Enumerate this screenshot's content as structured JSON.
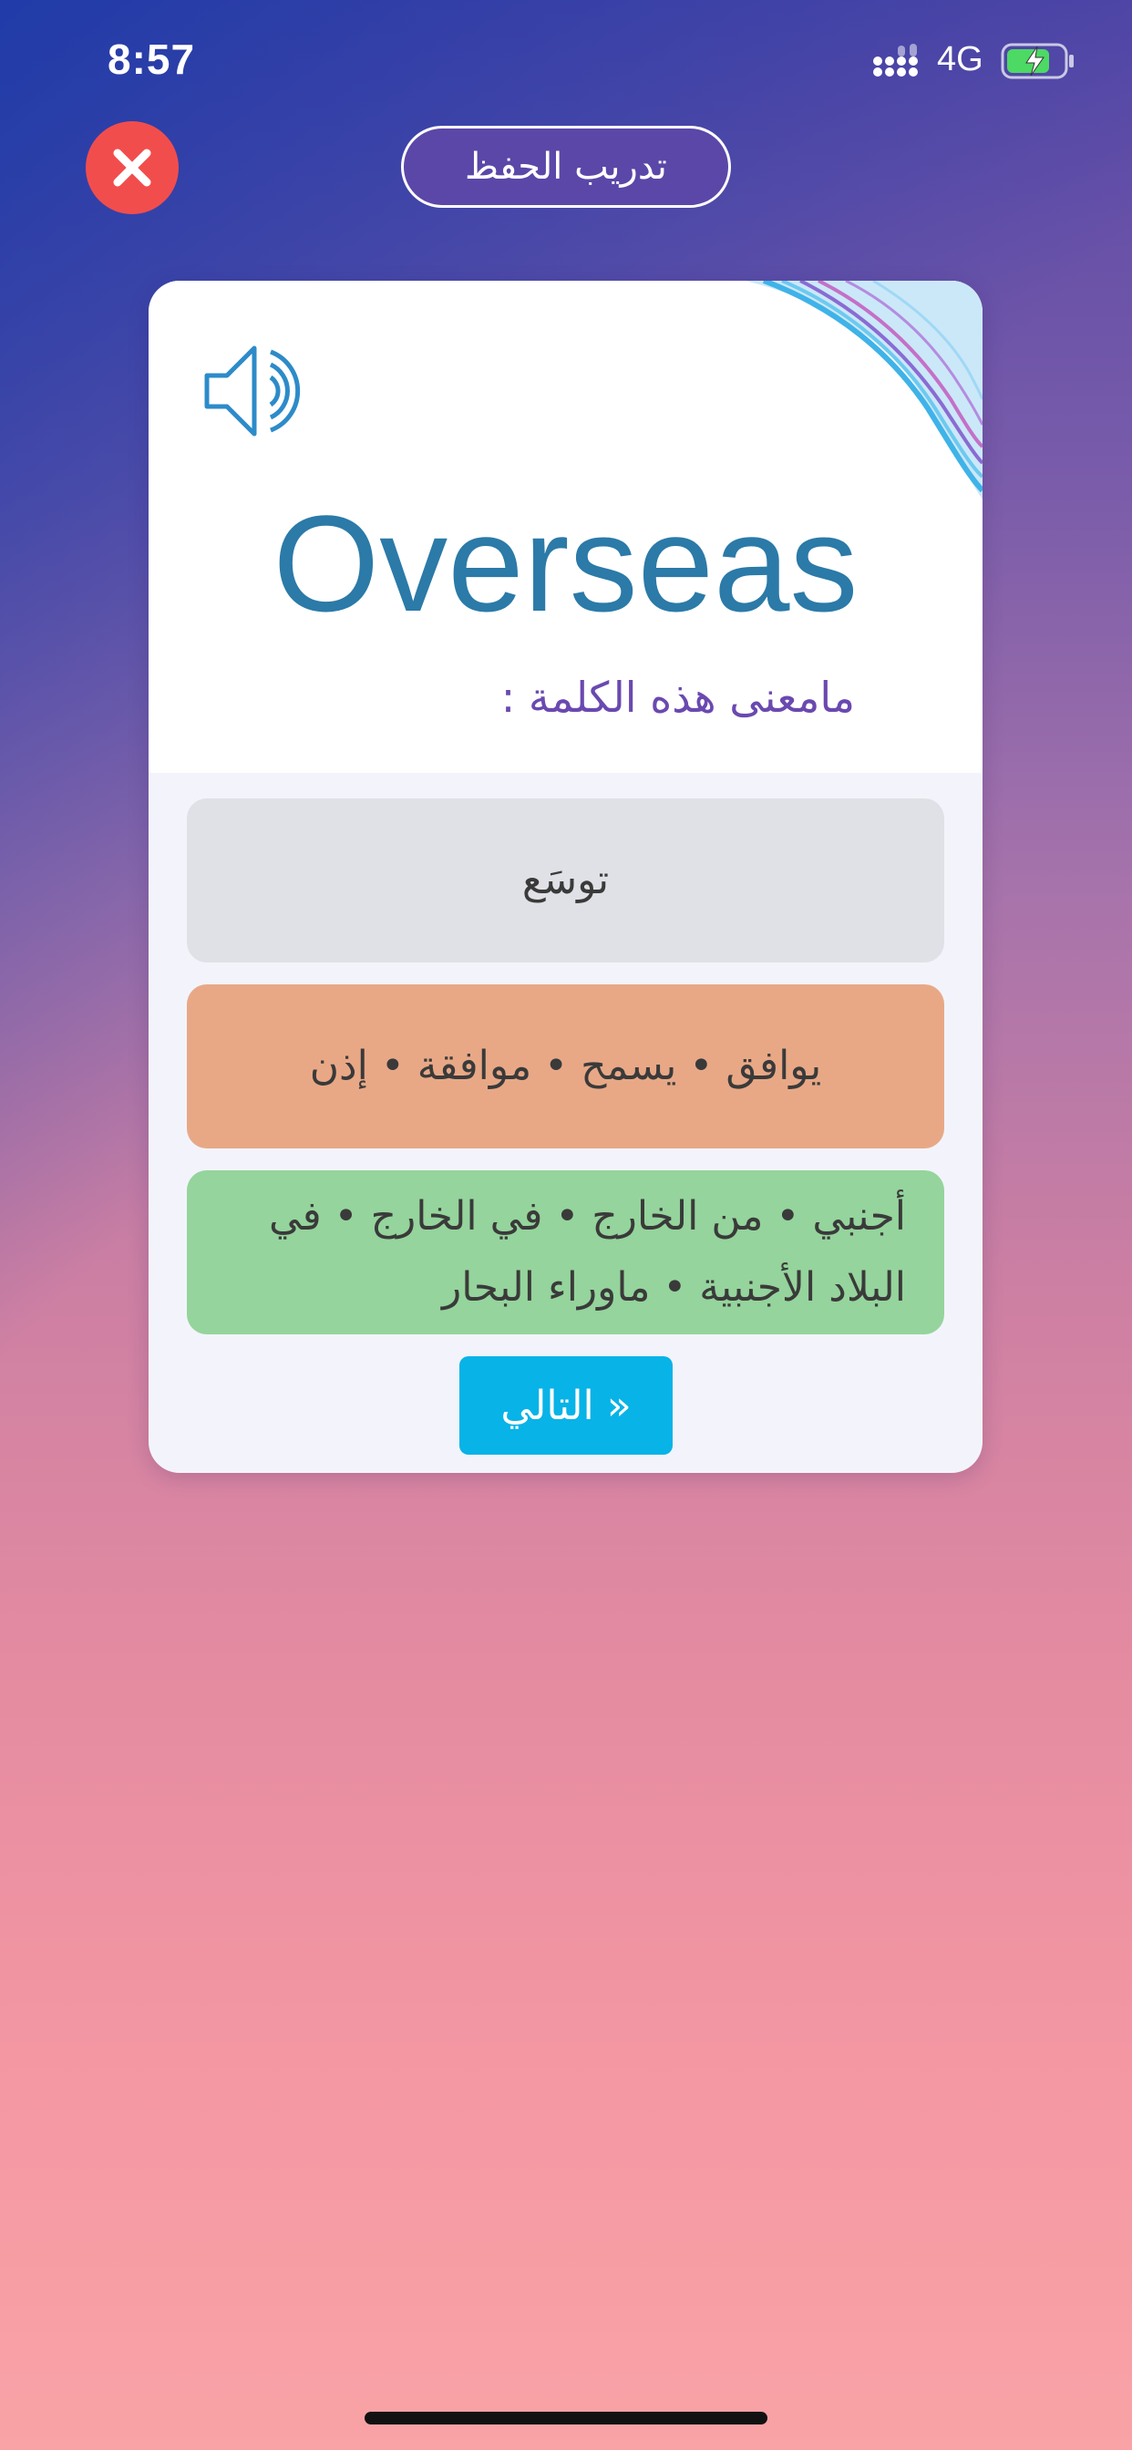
{
  "status_bar": {
    "time": "8:57",
    "network": "4G",
    "battery_color": "#4cd964",
    "charging_icon": "bolt-icon"
  },
  "header": {
    "title": "تدريب الحفظ",
    "close_icon": "close-icon",
    "close_color": "#f24d4d"
  },
  "card": {
    "speaker_icon": "speaker-icon",
    "word": "Overseas",
    "question": "مامعنى هذه الكلمة :",
    "options": [
      {
        "text": "توسَع",
        "color": "#e0e1e6"
      },
      {
        "text": "يوافق  •  يسمح  •  موافقة  •  إذن",
        "color": "#e8a886"
      },
      {
        "text": "أجنبي • من الخارج • في الخارج • في البلاد الأجنبية • ماوراء البحار",
        "color": "#95d49c"
      }
    ],
    "next_label": "« التالي",
    "next_color": "#08b3e7",
    "word_color": "#2b7aa8"
  }
}
